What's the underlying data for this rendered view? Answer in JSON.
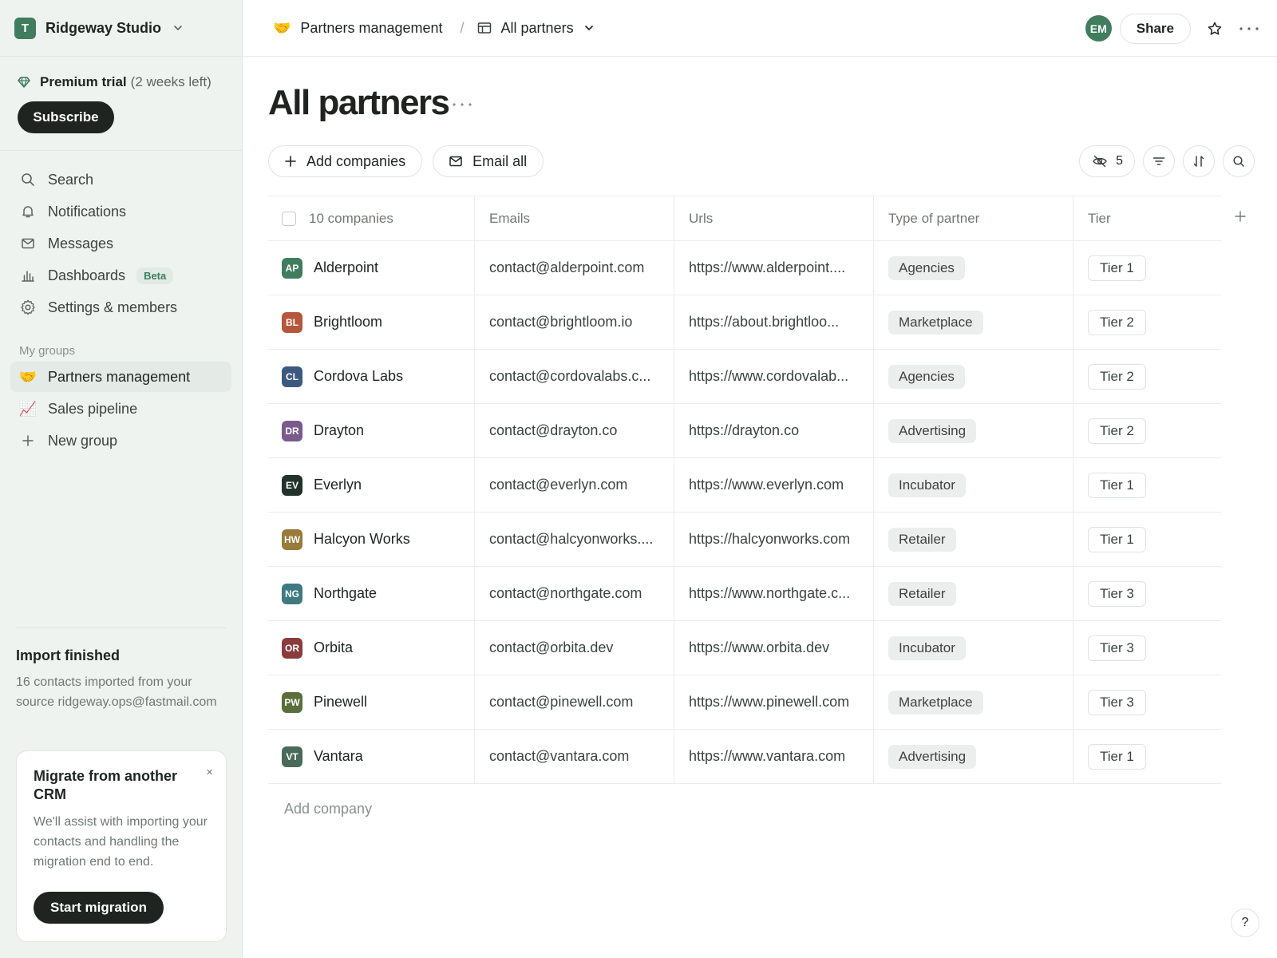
{
  "workspace": {
    "initial": "T",
    "name": "Ridgeway Studio"
  },
  "trial": {
    "title": "Premium trial",
    "remaining": "(2 weeks left)",
    "subscribe_label": "Subscribe"
  },
  "nav": {
    "search": "Search",
    "notifications": "Notifications",
    "messages": "Messages",
    "dashboards": "Dashboards",
    "dashboards_badge": "Beta",
    "settings": "Settings & members"
  },
  "groups": {
    "label": "My groups",
    "items": [
      {
        "emoji": "🤝",
        "label": "Partners management"
      },
      {
        "emoji": "📈",
        "label": "Sales pipeline"
      }
    ],
    "new_group": "New group"
  },
  "import": {
    "title": "Import finished",
    "text": "16 contacts imported from your source ridgeway.ops@fastmail.com"
  },
  "migrate": {
    "title": "Migrate from another CRM",
    "close": "×",
    "text": "We'll assist with importing your contacts and handling the migration end to end.",
    "button": "Start migration"
  },
  "breadcrumb": {
    "group_emoji": "🤝",
    "group": "Partners management",
    "separator": "/",
    "view": "All partners"
  },
  "header": {
    "avatar": "EM",
    "share": "Share"
  },
  "page": {
    "title": "All partners"
  },
  "toolbar": {
    "add_companies": "Add companies",
    "email_all": "Email all",
    "hidden_count": "5"
  },
  "table": {
    "columns": [
      "10 companies",
      "Emails",
      "Urls",
      "Type of partner",
      "Tier"
    ],
    "rows": [
      {
        "initials": "AP",
        "color": "#3f7d5e",
        "name": "Alderpoint",
        "email": "contact@alderpoint.com",
        "url": "https://www.alderpoint....",
        "type": "Agencies",
        "tier": "Tier 1"
      },
      {
        "initials": "BL",
        "color": "#b5573a",
        "name": "Brightloom",
        "email": "contact@brightloom.io",
        "url": "https://about.brightloo...",
        "type": "Marketplace",
        "tier": "Tier 2"
      },
      {
        "initials": "CL",
        "color": "#3c5a7f",
        "name": "Cordova Labs",
        "email": "contact@cordovalabs.c...",
        "url": "https://www.cordovalab...",
        "type": "Agencies",
        "tier": "Tier 2"
      },
      {
        "initials": "DR",
        "color": "#7a5a8c",
        "name": "Drayton",
        "email": "contact@drayton.co",
        "url": "https://drayton.co",
        "type": "Advertising",
        "tier": "Tier 2"
      },
      {
        "initials": "EV",
        "color": "#22332b",
        "name": "Everlyn",
        "email": "contact@everlyn.com",
        "url": "https://www.everlyn.com",
        "type": "Incubator",
        "tier": "Tier 1"
      },
      {
        "initials": "HW",
        "color": "#9a7a3a",
        "name": "Halcyon Works",
        "email": "contact@halcyonworks....",
        "url": "https://halcyonworks.com",
        "type": "Retailer",
        "tier": "Tier 1"
      },
      {
        "initials": "NG",
        "color": "#3f7a82",
        "name": "Northgate",
        "email": "contact@northgate.com",
        "url": "https://www.northgate.c...",
        "type": "Retailer",
        "tier": "Tier 3"
      },
      {
        "initials": "OR",
        "color": "#8a3c3c",
        "name": "Orbita",
        "email": "contact@orbita.dev",
        "url": "https://www.orbita.dev",
        "type": "Incubator",
        "tier": "Tier 3"
      },
      {
        "initials": "PW",
        "color": "#5a6e3a",
        "name": "Pinewell",
        "email": "contact@pinewell.com",
        "url": "https://www.pinewell.com",
        "type": "Marketplace",
        "tier": "Tier 3"
      },
      {
        "initials": "VT",
        "color": "#4a6a5a",
        "name": "Vantara",
        "email": "contact@vantara.com",
        "url": "https://www.vantara.com",
        "type": "Advertising",
        "tier": "Tier 1"
      }
    ],
    "add_company": "Add company"
  },
  "help": "?"
}
